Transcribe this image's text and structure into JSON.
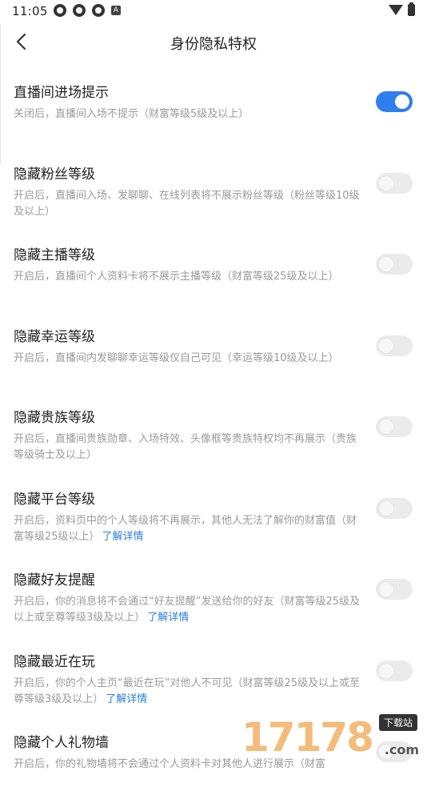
{
  "status_bar": {
    "time": "11:05",
    "notification_letter": "A",
    "left_icons": [
      "app-notification-icon",
      "app-notification-icon",
      "app-notification-icon",
      "a-notification-icon"
    ],
    "right_icons": [
      "wifi-icon",
      "battery-icon"
    ]
  },
  "header": {
    "title": "身份隐私特权",
    "back_icon": "back-arrow-icon"
  },
  "settings": [
    {
      "title": "直播间进场提示",
      "desc": "关闭后，直播间入场不提示（财富等级5级及以上）",
      "link": "",
      "enabled": true
    },
    {
      "title": "隐藏粉丝等级",
      "desc": "开启后，直播间入场、发聊聊、在线列表将不展示粉丝等级（粉丝等级10级及以上）",
      "link": "",
      "enabled": false
    },
    {
      "title": "隐藏主播等级",
      "desc": "开启后，直播间个人资料卡将不展示主播等级（财富等级25级及以上）",
      "link": "",
      "enabled": false
    },
    {
      "title": "隐藏幸运等级",
      "desc": "开启后，直播间内发聊聊幸运等级仅自己可见（幸运等级10级及以上）",
      "link": "",
      "enabled": false
    },
    {
      "title": "隐藏贵族等级",
      "desc": "开启后，直播间贵族勋章、入场特效、头像框等贵族特权均不再展示（贵族等级骑士及以上）",
      "link": "",
      "enabled": false
    },
    {
      "title": "隐藏平台等级",
      "desc": "开启后，资料页中的个人等级将不再展示，其他人无法了解你的财富值（财富等级25级以上）",
      "link": "了解详情",
      "enabled": false
    },
    {
      "title": "隐藏好友提醒",
      "desc": "开启后，你的消息将不会通过“好友提醒”发送给你的好友（财富等级25级及以上或至尊等级3级及以上）",
      "link": "了解详情",
      "enabled": false
    },
    {
      "title": "隐藏最近在玩",
      "desc": "开启后，你的个人主页“最近在玩”对他人不可见（财富等级25级及以上或至尊等级3级及以上）",
      "link": "了解详情",
      "enabled": false
    },
    {
      "title": "隐藏个人礼物墙",
      "desc": "开启后，你的礼物墙将不会通过个人资料卡对其他人进行展示（财富",
      "link": "",
      "enabled": false
    }
  ],
  "watermark": {
    "number": "17178",
    "badge": "下载站",
    "suffix": ".com"
  },
  "colors": {
    "toggle_on": "#2f7ef0",
    "toggle_off": "#ebebeb",
    "link": "#2a7de1",
    "desc_text": "#9a9a9a",
    "title_text": "#222222"
  }
}
